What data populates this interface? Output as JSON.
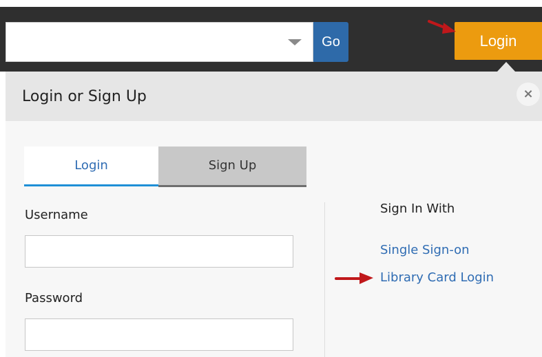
{
  "header": {
    "search_placeholder": "",
    "go_label": "Go",
    "login_label": "Login"
  },
  "panel": {
    "title": "Login or Sign Up",
    "close_glyph": "×",
    "tabs": [
      {
        "label": "Login",
        "active": true
      },
      {
        "label": "Sign Up",
        "active": false
      }
    ],
    "username_label": "Username",
    "username_value": "",
    "password_label": "Password",
    "password_value": "",
    "sign_in_with": "Sign In With",
    "links": [
      {
        "label": "Single Sign-on"
      },
      {
        "label": "Library Card Login"
      }
    ]
  },
  "colors": {
    "topbar": "#2f2f2f",
    "go_button": "#2e6aa9",
    "login_button": "#ec9b0f",
    "link": "#2f6cb3",
    "active_tab_underline": "#1e8fd6",
    "annotation_arrow": "#c0181b"
  },
  "icons": {
    "dropdown": "chevron-down-icon",
    "close": "close-icon",
    "annotation": "red-arrow-icon"
  }
}
